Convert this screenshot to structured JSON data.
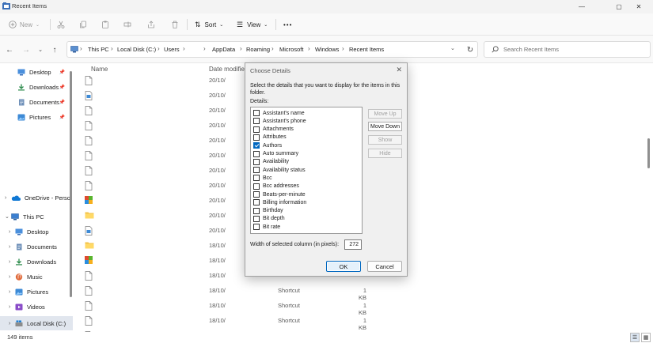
{
  "window": {
    "title": "Recent Items",
    "minimize_glyph": "—",
    "maximize_glyph": "▢",
    "close_glyph": "✕"
  },
  "toolbar": {
    "new_label": "New",
    "sort_label": "Sort",
    "view_label": "View",
    "more_label": "•••"
  },
  "address": {
    "breadcrumbs": [
      "This PC",
      "Local Disk (C:)",
      "Users",
      "AppData",
      "Roaming",
      "Microsoft",
      "Windows",
      "Recent Items"
    ],
    "separator": "›",
    "search_placeholder": "Search Recent Items"
  },
  "sidebar": {
    "quick_access": [
      {
        "label": "Desktop",
        "icon": "desktop-icon"
      },
      {
        "label": "Downloads",
        "icon": "download-icon"
      },
      {
        "label": "Documents",
        "icon": "documents-icon"
      },
      {
        "label": "Pictures",
        "icon": "pictures-icon"
      }
    ],
    "onedrive": "OneDrive - Perso",
    "this_pc": "This PC",
    "this_pc_items": [
      {
        "label": "Desktop",
        "icon": "desktop-icon"
      },
      {
        "label": "Documents",
        "icon": "documents-icon"
      },
      {
        "label": "Downloads",
        "icon": "download-icon"
      },
      {
        "label": "Music",
        "icon": "music-icon"
      },
      {
        "label": "Pictures",
        "icon": "pictures-icon"
      },
      {
        "label": "Videos",
        "icon": "videos-icon"
      },
      {
        "label": "Local Disk (C:)",
        "icon": "drive-icon"
      }
    ]
  },
  "list": {
    "columns": {
      "name": "Name",
      "date": "Date modified"
    },
    "rows": [
      {
        "date": "20/10/",
        "type": "",
        "size": "",
        "icon": "file-icon"
      },
      {
        "date": "20/10/",
        "type": "",
        "size": "",
        "icon": "image-file-icon"
      },
      {
        "date": "20/10/",
        "type": "",
        "size": "",
        "icon": "file-icon"
      },
      {
        "date": "20/10/",
        "type": "",
        "size": "",
        "icon": "file-icon"
      },
      {
        "date": "20/10/",
        "type": "",
        "size": "",
        "icon": "file-icon"
      },
      {
        "date": "20/10/",
        "type": "",
        "size": "",
        "icon": "file-icon"
      },
      {
        "date": "20/10/",
        "type": "",
        "size": "",
        "icon": "file-icon"
      },
      {
        "date": "20/10/",
        "type": "",
        "size": "",
        "icon": "file-icon"
      },
      {
        "date": "20/10/",
        "type": "",
        "size": "",
        "icon": "app-icon"
      },
      {
        "date": "20/10/",
        "type": "",
        "size": "",
        "icon": "folder-icon"
      },
      {
        "date": "20/10/",
        "type": "",
        "size": "",
        "icon": "image-file-icon"
      },
      {
        "date": "18/10/",
        "type": "",
        "size": "",
        "icon": "folder-icon"
      },
      {
        "date": "18/10/",
        "type": "",
        "size": "",
        "icon": "app-icon"
      },
      {
        "date": "18/10/",
        "type": "",
        "size": "",
        "icon": "file-icon"
      },
      {
        "date": "18/10/",
        "type": "Shortcut",
        "size": "1 KB",
        "icon": "file-icon"
      },
      {
        "date": "18/10/",
        "type": "Shortcut",
        "size": "1 KB",
        "icon": "file-icon"
      },
      {
        "date": "18/10/",
        "type": "Shortcut",
        "size": "1 KB",
        "icon": "file-icon"
      },
      {
        "date": "18/10/",
        "type": "Shortcut",
        "size": "1 KB",
        "icon": "file-icon"
      }
    ]
  },
  "status": {
    "count": "149 items"
  },
  "dialog": {
    "title": "Choose Details",
    "description": "Select the details that you want to display for the items in this folder.",
    "details_label": "Details:",
    "items": [
      {
        "label": "Assistant's name",
        "checked": false
      },
      {
        "label": "Assistant's phone",
        "checked": false
      },
      {
        "label": "Attachments",
        "checked": false
      },
      {
        "label": "Attributes",
        "checked": false
      },
      {
        "label": "Authors",
        "checked": true
      },
      {
        "label": "Auto summary",
        "checked": false
      },
      {
        "label": "Availability",
        "checked": false
      },
      {
        "label": "Availability status",
        "checked": false
      },
      {
        "label": "Bcc",
        "checked": false
      },
      {
        "label": "Bcc addresses",
        "checked": false
      },
      {
        "label": "Beats-per-minute",
        "checked": false
      },
      {
        "label": "Billing information",
        "checked": false
      },
      {
        "label": "Birthday",
        "checked": false
      },
      {
        "label": "Bit depth",
        "checked": false
      },
      {
        "label": "Bit rate",
        "checked": false
      }
    ],
    "buttons": {
      "move_up": "Move Up",
      "move_down": "Move Down",
      "show": "Show",
      "hide": "Hide",
      "ok": "OK",
      "cancel": "Cancel"
    },
    "width_label": "Width of selected column (in pixels):",
    "width_value": "272"
  },
  "colors": {
    "accent": "#0067c0",
    "selection": "#e1e6ee"
  }
}
